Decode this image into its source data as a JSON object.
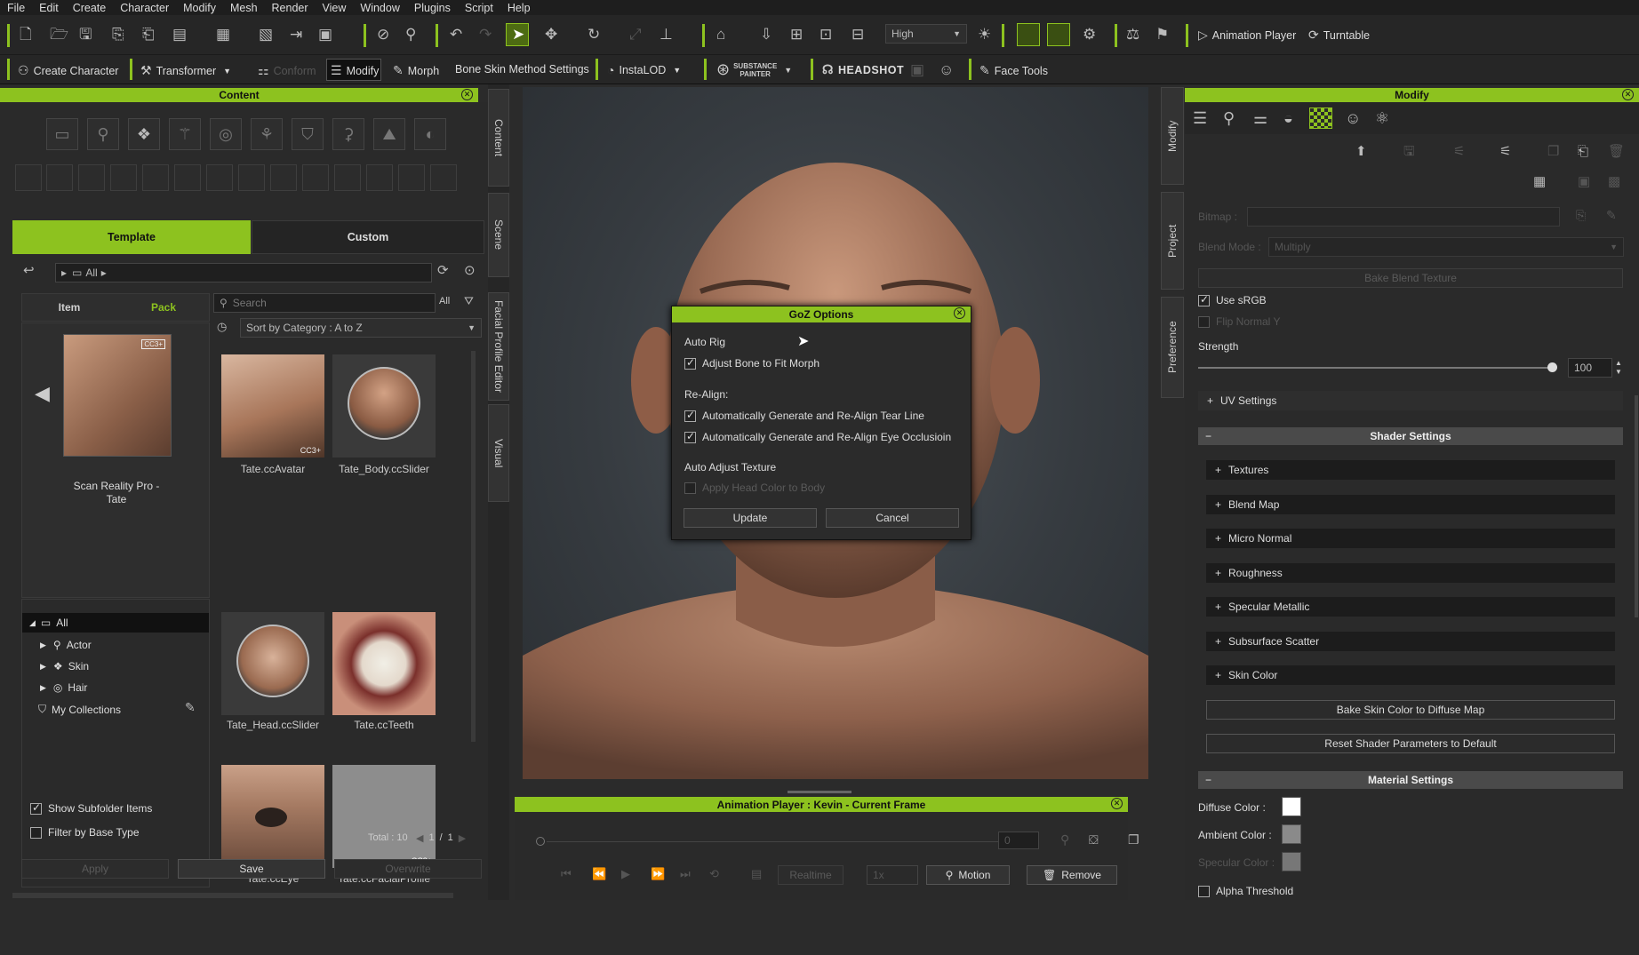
{
  "menu": [
    "File",
    "Edit",
    "Create",
    "Character",
    "Modify",
    "Mesh",
    "Render",
    "View",
    "Window",
    "Plugins",
    "Script",
    "Help"
  ],
  "toolbar1": {
    "quality": "High",
    "animation_player": "Animation Player",
    "turntable": "Turntable"
  },
  "toolbar2": {
    "create_character": "Create Character",
    "transformer": "Transformer",
    "conform": "Conform",
    "modify": "Modify",
    "morph": "Morph",
    "bone_skin": "Bone Skin Method Settings",
    "instalod": "InstaLOD",
    "substance_1": "SUBSTANCE",
    "substance_2": "PAINTER",
    "headshot": "HEADSHOT",
    "face_tools": "Face Tools"
  },
  "content": {
    "title": "Content",
    "tab_template": "Template",
    "tab_custom": "Custom",
    "path": "All",
    "item_tab": "Item",
    "pack_tab": "Pack",
    "preview_caption_1": "Scan Reality Pro -",
    "preview_caption_2": "Tate",
    "search_placeholder": "Search",
    "filter_all": "All",
    "sort": "Sort by Category : A to Z",
    "tree": [
      "All",
      "Actor",
      "Skin",
      "Hair",
      "My Collections"
    ],
    "items": [
      "Tate.ccAvatar",
      "Tate_Body.ccSlider",
      "Tate_Head.ccSlider",
      "Tate.ccTeeth",
      "Tate.ccEye",
      "Tate.ccFacialProfile"
    ],
    "badge": "CC3+",
    "show_subfolder": "Show Subfolder Items",
    "filter_base": "Filter by Base Type",
    "total": "Total : 10",
    "page_cur": "1",
    "page_total": "1",
    "apply": "Apply",
    "save": "Save",
    "overwrite": "Overwrite"
  },
  "side_tabs": [
    "Content",
    "Scene",
    "Facial Profile Editor",
    "Visual"
  ],
  "goz": {
    "title": "GoZ Options",
    "auto_rig": "Auto Rig",
    "adjust_bone": "Adjust Bone to Fit Morph",
    "realign": "Re-Align:",
    "tear_line": "Automatically Generate and Re-Align Tear Line",
    "eye_occ": "Automatically Generate and Re-Align Eye Occlusioin",
    "auto_adjust": "Auto Adjust Texture",
    "apply_head": "Apply Head Color to Body",
    "update": "Update",
    "cancel": "Cancel"
  },
  "anim_player": {
    "title": "Animation Player : Kevin - Current Frame",
    "frame": "0",
    "realtime": "Realtime",
    "speed": "1x",
    "motion": "Motion",
    "remove": "Remove"
  },
  "modify": {
    "title": "Modify",
    "right_tabs": [
      "Modify",
      "Project",
      "Preference"
    ],
    "bitmap": "Bitmap :",
    "blend_mode": "Blend Mode :",
    "blend_value": "Multiply",
    "bake_blend": "Bake Blend Texture",
    "use_srgb": "Use sRGB",
    "flip_normal": "Flip Normal Y",
    "strength": "Strength",
    "strength_value": "100",
    "uv_settings": "UV Settings",
    "shader_settings": "Shader Settings",
    "sections": [
      "Textures",
      "Blend Map",
      "Micro Normal",
      "Roughness",
      "Specular Metallic",
      "Subsurface Scatter",
      "Skin Color"
    ],
    "bake_skin": "Bake Skin Color to Diffuse Map",
    "reset_shader": "Reset Shader Parameters to Default",
    "material_settings": "Material Settings",
    "diffuse": "Diffuse Color :",
    "ambient": "Ambient Color :",
    "specular": "Specular Color :",
    "alpha": "Alpha Threshold"
  },
  "colors": {
    "accent": "#8dc21f",
    "diffuse": "#ffffff",
    "ambient": "#8a8a8a"
  }
}
